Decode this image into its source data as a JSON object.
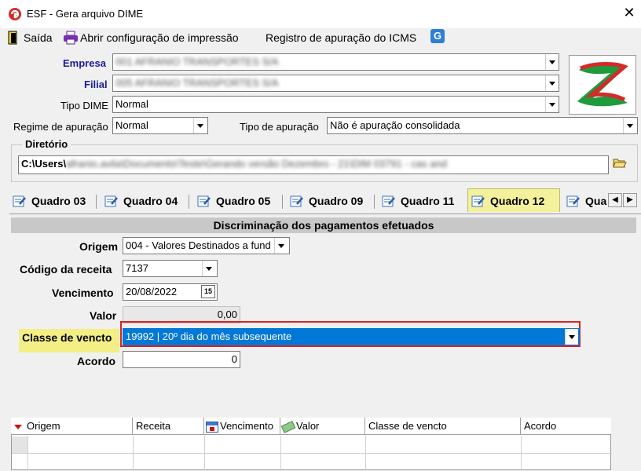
{
  "window": {
    "title": "ESF - Gera arquivo DIME",
    "close_label": "✕"
  },
  "toolbar": {
    "exit_label": "Saída",
    "print_config_label": "Abrir configuração de impressão",
    "icms_label": "Registro de apuração do ICMS"
  },
  "form": {
    "empresa_label": "Empresa",
    "empresa_value": "001 AFRANIO TRANSPORTES S/A",
    "filial_label": "Filial",
    "filial_value": "005 AFRANIO TRANSPORTES S/A",
    "tipo_dime_label": "Tipo DIME",
    "tipo_dime_value": "Normal",
    "regime_label": "Regime de apuração",
    "regime_value": "Normal",
    "tipo_apuracao_label": "Tipo de apuração",
    "tipo_apuracao_value": "Não é apuração consolidada",
    "diretorio_label": "Diretório",
    "diretorio_prefix": "C:\\Users\\",
    "diretorio_rest": "afranio.avila\\Documents\\Teste\\Gerando versão Dezembro - 21\\DIM 03791 - cas and"
  },
  "tabs": [
    {
      "label": "Quadro 03"
    },
    {
      "label": "Quadro 04"
    },
    {
      "label": "Quadro 05"
    },
    {
      "label": "Quadro 09"
    },
    {
      "label": "Quadro 11"
    },
    {
      "label": "Quadro 12"
    },
    {
      "label": "Qua"
    }
  ],
  "panel": {
    "header": "Discriminação dos pagamentos efetuados",
    "origem_label": "Origem",
    "origem_value": "004 - Valores Destinados a fund",
    "codigo_label": "Código da receita",
    "codigo_value": "7137",
    "vencimento_label": "Vencimento",
    "vencimento_value": "20/08/2022",
    "calendar_icon_text": "15",
    "valor_label": "Valor",
    "valor_value": "0,00",
    "classe_label": "Classe de vencto",
    "classe_value": "19992 | 20º dia do mês subsequente",
    "acordo_label": "Acordo",
    "acordo_value": "0"
  },
  "grid": {
    "columns": [
      "Origem",
      "Receita",
      "Vencimento",
      "Valor",
      "Classe de vencto",
      "Acordo"
    ]
  },
  "colors": {
    "tab_active_bg": "#f4f19c",
    "label_highlight": "#f3ef86",
    "selection_blue": "#0078d7",
    "focus_border": "#e02020",
    "label_blue": "#1b1b9a"
  }
}
